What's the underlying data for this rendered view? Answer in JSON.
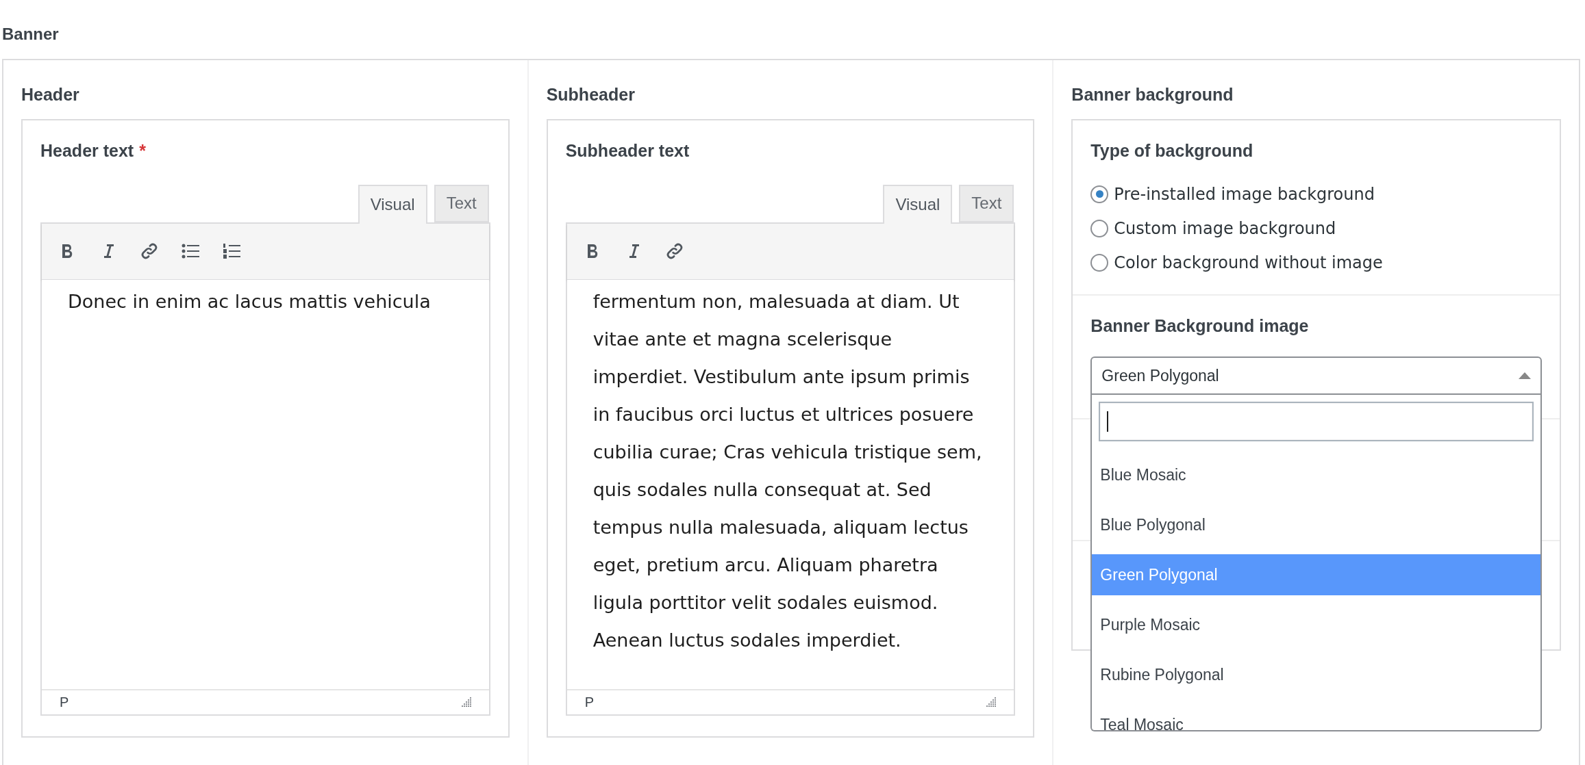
{
  "section_title": "Banner",
  "columns": [
    {
      "kind": "editor",
      "title": "Header",
      "field_label": "Header text",
      "required_mark": "*",
      "tabs": [
        {
          "label": "Visual",
          "selected": true
        },
        {
          "label": "Text",
          "selected": false
        }
      ],
      "list_buttons": true,
      "content": "Donec in enim ac lacus mattis vehicula",
      "path": "P"
    },
    {
      "kind": "editor",
      "title": "Subheader",
      "field_label": "Subheader text",
      "tabs": [
        {
          "label": "Visual",
          "selected": true
        },
        {
          "label": "Text",
          "selected": false
        }
      ],
      "list_buttons": false,
      "content": "fermentum non, malesuada at diam. Ut vitae ante et magna scelerisque imperdiet. Vestibulum ante ipsum primis in faucibus orci luctus et ultrices posuere cubilia curae; Cras vehicula tristique sem, quis sodales nulla consequat at. Sed tempus nulla malesuada, aliquam lectus eget, pretium arcu. Aliquam pharetra ligula porttitor velit sodales euismod. Aenean luctus sodales imperdiet.",
      "path": "P"
    },
    {
      "kind": "background",
      "title": "Banner background",
      "type_label": "Type of background",
      "radios": [
        {
          "label": "Pre-installed image background",
          "selected": true
        },
        {
          "label": "Custom image background",
          "selected": false
        },
        {
          "label": "Color background without image",
          "selected": false
        }
      ],
      "image_label": "Banner Background image",
      "select": {
        "value": "Green Polygonal",
        "expanded": true,
        "options": [
          {
            "label": "Blue Mosaic",
            "selected": false
          },
          {
            "label": "Blue Polygonal",
            "selected": false
          },
          {
            "label": "Green Polygonal",
            "selected": true
          },
          {
            "label": "Purple Mosaic",
            "selected": false
          },
          {
            "label": "Rubine Polygonal",
            "selected": false
          },
          {
            "label": "Teal Mosaic",
            "selected": false
          }
        ]
      }
    }
  ]
}
